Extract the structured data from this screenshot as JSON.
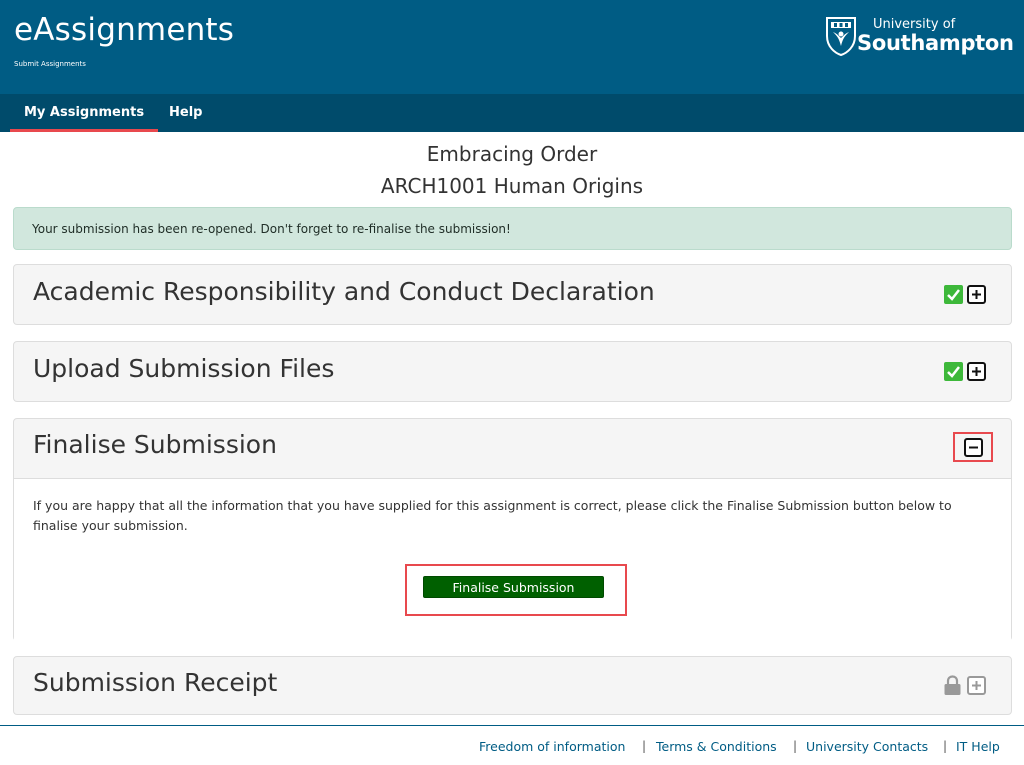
{
  "header": {
    "app_title": "eAssignments",
    "app_subtitle": "Submit Assignments",
    "logo_line1": "University of",
    "logo_line2": "Southampton",
    "background": "#005C84"
  },
  "nav": {
    "items": [
      {
        "label": "My Assignments",
        "active": true
      },
      {
        "label": "Help",
        "active": false
      }
    ]
  },
  "page": {
    "assignment_title": "Embracing Order",
    "module_title": "ARCH1001 Human Origins"
  },
  "alert": {
    "message": "Your submission has been re-opened. Don't forget to re-finalise the submission!"
  },
  "panels": [
    {
      "heading": "Academic Responsibility and Conduct Declaration",
      "status": "complete",
      "state": "collapsed"
    },
    {
      "heading": "Upload Submission Files",
      "status": "complete",
      "state": "collapsed"
    },
    {
      "heading": "Finalise Submission",
      "status": "pending",
      "state": "expanded",
      "body_text": "If you are happy that all the information that you have supplied for this assignment is correct, please click the Finalise Submission button below to finalise your submission.",
      "button_label": "Finalise Submission"
    },
    {
      "heading": "Submission Receipt",
      "status": "locked",
      "state": "collapsed"
    }
  ],
  "footer": {
    "links": [
      "Freedom of information",
      "Terms & Conditions",
      "University Contacts",
      "IT Help"
    ],
    "separator": "|"
  },
  "colors": {
    "brand": "#005C84",
    "nav": "#004B6B",
    "highlight": "#E8494E",
    "success": "#3DB83A",
    "finalise_button": "#006000"
  }
}
